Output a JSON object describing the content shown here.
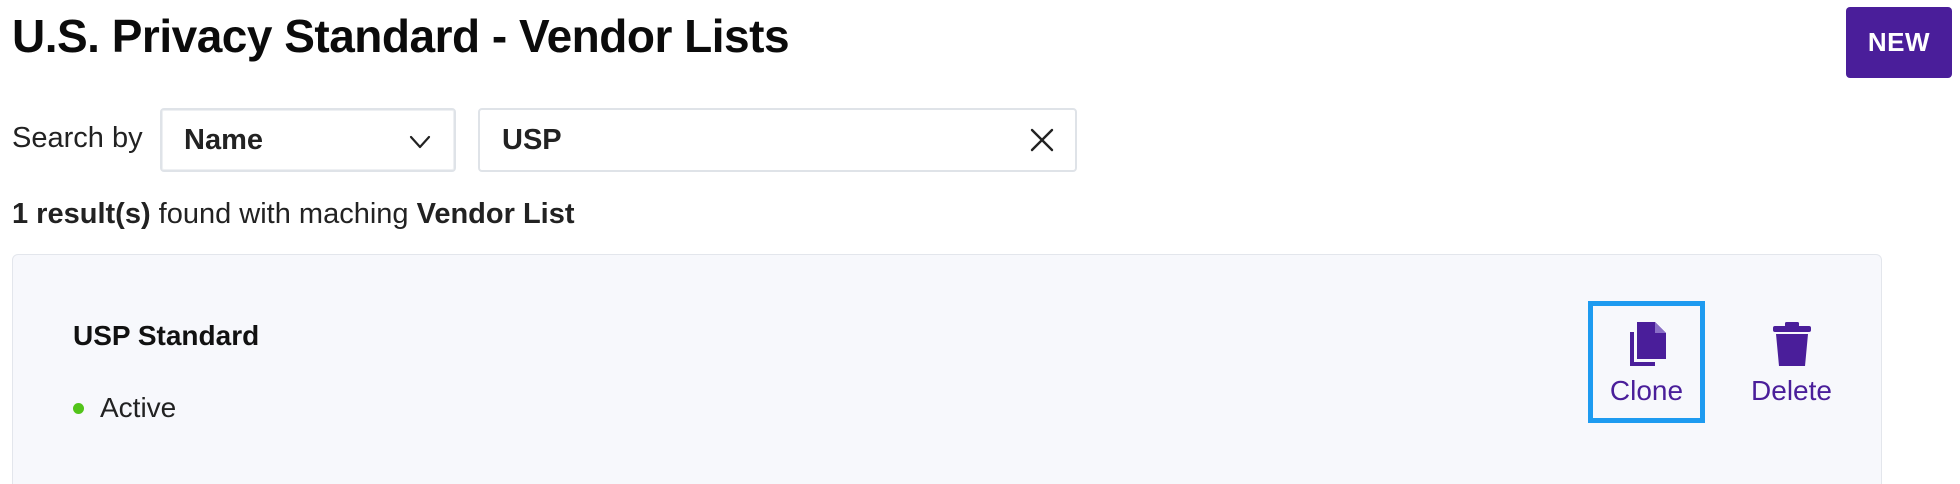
{
  "header": {
    "title": "U.S. Privacy Standard - Vendor Lists",
    "new_label": "NEW"
  },
  "search": {
    "label": "Search by",
    "field_selected": "Name",
    "query": "USP"
  },
  "results": {
    "count_text": "1 result(s)",
    "middle_text": " found with maching ",
    "entity": "Vendor List"
  },
  "vendor_lists": [
    {
      "name": "USP Standard",
      "status": "Active",
      "actions": {
        "clone_label": "Clone",
        "delete_label": "Delete"
      }
    }
  ],
  "colors": {
    "accent": "#4a1e9a",
    "focus": "#1e9bf0",
    "status_active": "#52c41a"
  },
  "icons": {
    "select": "chevron-down-icon",
    "clear": "close-icon",
    "clone": "copy-icon",
    "delete": "trash-icon"
  }
}
